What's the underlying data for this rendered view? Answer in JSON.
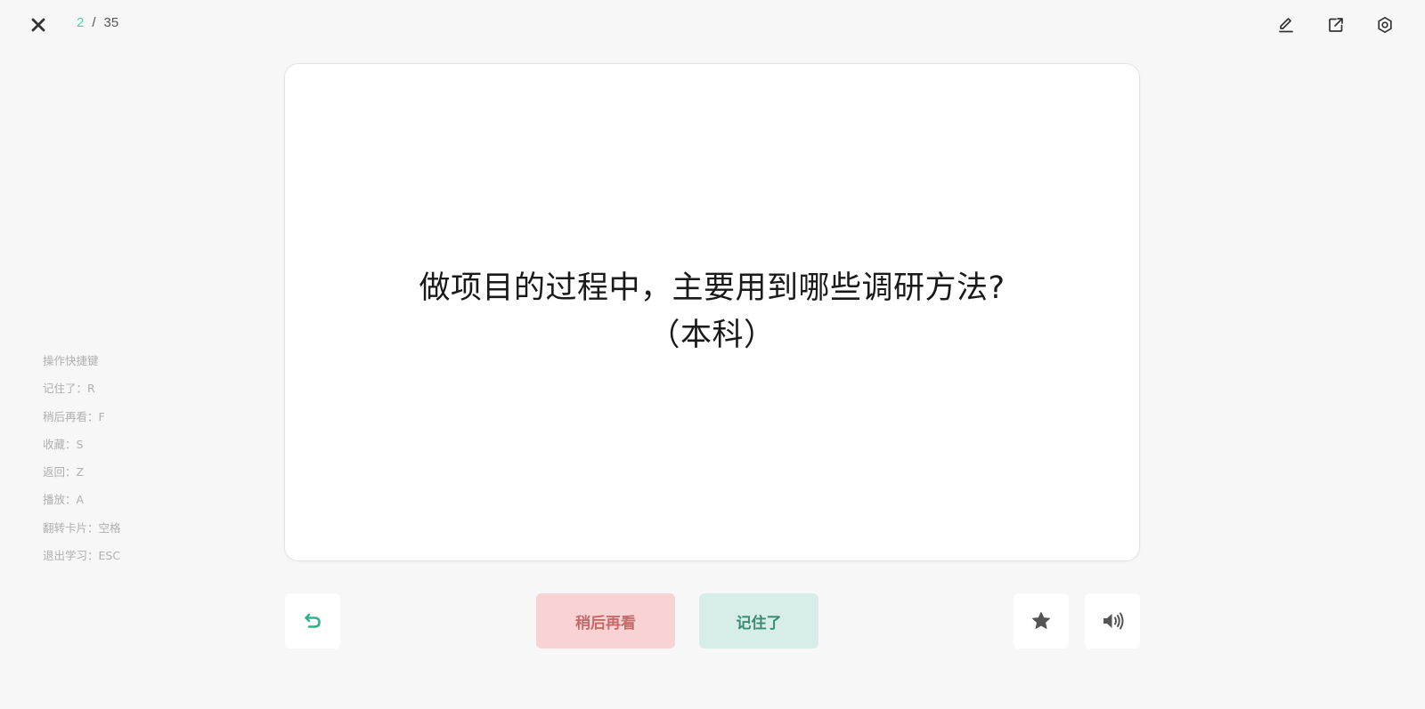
{
  "header": {
    "current": "2",
    "separator": "/",
    "total": "35"
  },
  "icons": {
    "close": "close-icon",
    "edit": "edit-icon",
    "share": "share-icon",
    "settings": "gear-icon",
    "undo": "undo-icon",
    "star": "star-icon",
    "sound": "speaker-icon"
  },
  "shortcuts": {
    "title": "操作快捷键",
    "items": [
      "记住了：R",
      "稍后再看：F",
      "收藏：S",
      "返回：Z",
      "播放：A",
      "翻转卡片：空格",
      "退出学习：ESC"
    ]
  },
  "card": {
    "line1": "做项目的过程中，主要用到哪些调研方法?",
    "line2": "（本科）"
  },
  "actions": {
    "later_label": "稍后再看",
    "remember_label": "记住了"
  },
  "colors": {
    "accent": "#5fc6a6",
    "later_bg": "#f9d3d3",
    "later_text": "#c46a6a",
    "remember_bg": "#d7ede8",
    "remember_text": "#3b8a76",
    "background": "#f7f7f7"
  }
}
